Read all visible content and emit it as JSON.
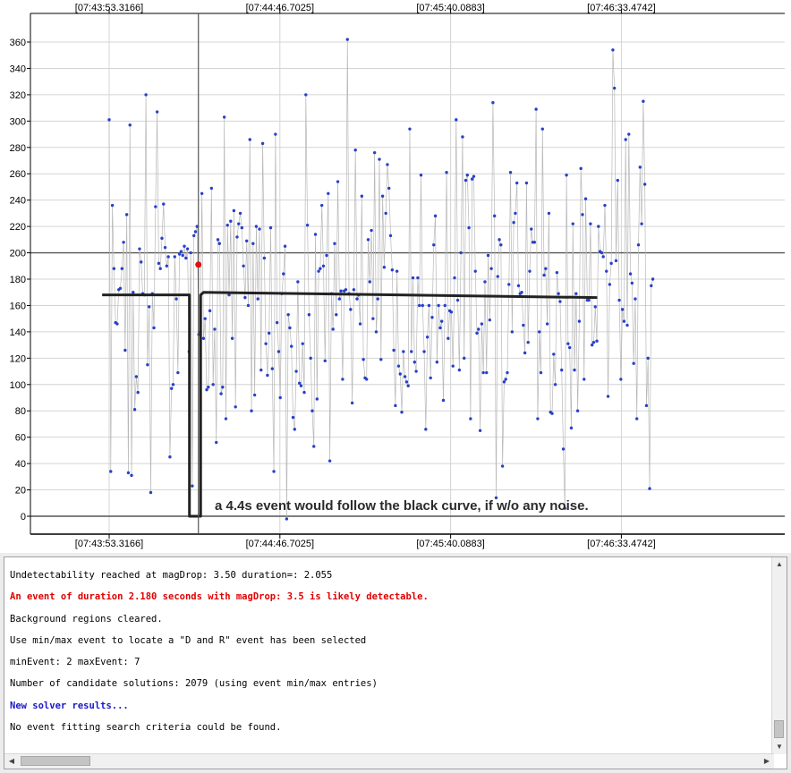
{
  "chart_data": {
    "type": "scatter",
    "x_tick_labels": [
      "[07:43:53.3166]",
      "[07:44:46.7025]",
      "[07:45:40.0883]",
      "[07:46:33.4742]"
    ],
    "x_tick_positions": [
      0,
      53.3859,
      106.7717,
      160.1576
    ],
    "xlim": [
      -24.3,
      205.3
    ],
    "y_ticks": [
      0,
      20,
      40,
      60,
      80,
      100,
      120,
      140,
      160,
      180,
      200,
      220,
      240,
      260,
      280,
      300,
      320,
      340,
      360
    ],
    "ylim": [
      -10,
      370
    ],
    "grid": true,
    "reference_lines_y": [
      0,
      200
    ],
    "cursor_x": 27.9,
    "highlight_point": {
      "x": 27.9,
      "y": 191
    },
    "samples": [
      301,
      34,
      236,
      188,
      147,
      146,
      172,
      173,
      188,
      208,
      126,
      229,
      33,
      297,
      31,
      170,
      81,
      106,
      94,
      203,
      193,
      169,
      168,
      320,
      115,
      159,
      18,
      169,
      143,
      235,
      307,
      192,
      188,
      211,
      237,
      204,
      190,
      197,
      45,
      97,
      100,
      197,
      165,
      109,
      199,
      201,
      198,
      205,
      196,
      203,
      125,
      200,
      23,
      213,
      216,
      220,
      138,
      140,
      245,
      135,
      150,
      96,
      98,
      156,
      249,
      100,
      142,
      56,
      210,
      207,
      93,
      98,
      303,
      74,
      221,
      168,
      224,
      135,
      232,
      83,
      212,
      222,
      230,
      219,
      190,
      166,
      209,
      160,
      286,
      80,
      207,
      92,
      220,
      165,
      218,
      111,
      283,
      196,
      131,
      107,
      139,
      219,
      112,
      34,
      290,
      147,
      125,
      90,
      169,
      184,
      205,
      -2,
      153,
      143,
      129,
      75,
      66,
      110,
      178,
      101,
      99,
      131,
      94,
      320,
      221,
      153,
      120,
      80,
      53,
      214,
      89,
      186,
      188,
      236,
      190,
      118,
      198,
      245,
      42,
      169,
      142,
      207,
      153,
      254,
      165,
      171,
      104,
      171,
      172,
      362,
      169,
      157,
      86,
      172,
      278,
      165,
      168,
      146,
      243,
      119,
      105,
      104,
      210,
      178,
      217,
      150,
      276,
      140,
      165,
      271,
      119,
      243,
      189,
      230,
      267,
      249,
      213,
      187,
      126,
      84,
      186,
      114,
      108,
      79,
      125,
      106,
      102,
      99,
      294,
      125,
      181,
      117,
      110,
      181,
      160,
      259,
      160,
      125,
      66,
      136,
      160,
      105,
      151,
      206,
      228,
      117,
      160,
      143,
      148,
      88,
      160,
      261,
      135,
      156,
      155,
      114,
      181,
      301,
      164,
      111,
      200,
      288,
      120,
      255,
      259,
      219,
      74,
      256,
      258,
      186,
      139,
      142,
      65,
      146,
      109,
      178,
      109,
      198,
      149,
      188,
      314,
      228,
      14,
      182,
      210,
      206,
      38,
      102,
      104,
      109,
      176,
      261,
      140,
      223,
      230,
      253,
      175,
      169,
      170,
      145,
      124,
      253,
      132,
      186,
      218,
      208,
      208,
      309,
      74,
      140,
      109,
      294,
      183,
      188,
      146,
      230,
      79,
      78,
      123,
      100,
      185,
      169,
      163,
      111,
      51,
      6,
      259,
      131,
      128,
      67,
      222,
      111,
      169,
      80,
      148,
      264,
      229,
      104,
      241,
      164,
      164,
      222,
      130,
      132,
      159,
      133,
      220,
      201,
      200,
      197,
      236,
      186,
      91,
      176,
      192,
      354,
      325,
      194,
      255,
      164,
      104,
      157,
      148,
      286,
      145,
      290,
      184,
      177,
      116,
      165,
      74,
      206,
      265,
      222,
      315,
      252,
      84,
      120,
      21,
      175,
      180
    ]
  },
  "annotation": {
    "text": "a 4.4s event would follow the black curve, if w/o any noise."
  },
  "log": {
    "lines": [
      {
        "text": "Undetectability reached at magDrop: 3.50 duration=: 2.055",
        "style": "normal"
      },
      {
        "text": "An event of duration 2.180 seconds with magDrop: 3.5 is likely detectable.",
        "style": "red"
      },
      {
        "text": "Background regions cleared.",
        "style": "normal"
      },
      {
        "text": "Use min/max event to locate a \"D and R\" event has been selected",
        "style": "normal"
      },
      {
        "text": "minEvent: 2 maxEvent: 7",
        "style": "normal"
      },
      {
        "text": "Number of candidate solutions: 2079 (using event min/max entries)",
        "style": "normal"
      },
      {
        "text": "New solver results...",
        "style": "blue"
      },
      {
        "text": "No event fitting search criteria could be found.",
        "style": "normal"
      }
    ]
  },
  "scrollbar": {
    "up": "▲",
    "down": "▼",
    "left": "◀",
    "right": "▶"
  }
}
